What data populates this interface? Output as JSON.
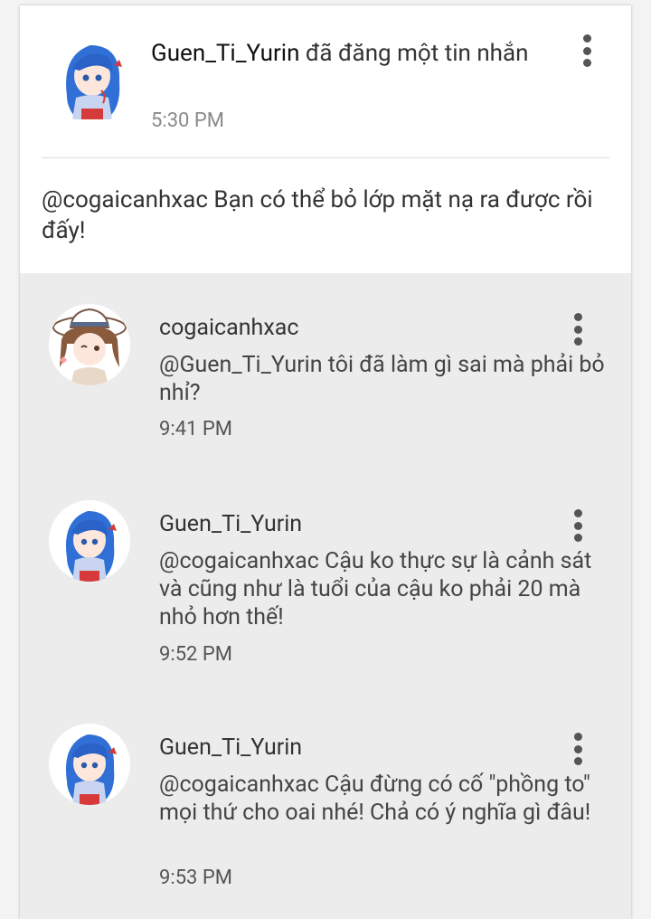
{
  "post": {
    "author": "Guen_Ti_Yurin",
    "action": " đã đăng một tin nhắn",
    "time": "5:30 PM",
    "body": "@cogaicanhxac Bạn có thể bỏ lớp mặt nạ ra được rồi đấy!",
    "more_icon": "more-vertical-icon"
  },
  "comments": [
    {
      "author": "cogaicanhxac",
      "text": "@Guen_Ti_Yurin  tôi đã làm gì sai mà phải bỏ nhỉ?",
      "time": "9:41 PM",
      "avatar": "brown-hat-girl-avatar"
    },
    {
      "author": "Guen_Ti_Yurin",
      "text": "@cogaicanhxac Cậu ko thực sự là cảnh sát và cũng như là tuổi của cậu ko phải 20 mà nhỏ hơn thế!",
      "time": "9:52 PM",
      "avatar": "blue-hair-girl-avatar"
    },
    {
      "author": "Guen_Ti_Yurin",
      "text": "@cogaicanhxac Cậu đừng có cố \"phồng to\" mọi thứ cho oai nhé! Chả có ý nghĩa gì đâu!",
      "time": "9:53 PM",
      "avatar": "blue-hair-girl-avatar"
    }
  ],
  "colors": {
    "card_bg": "#ffffff",
    "comments_bg": "#ececec",
    "text": "#333333",
    "muted": "#8a8a8a"
  }
}
